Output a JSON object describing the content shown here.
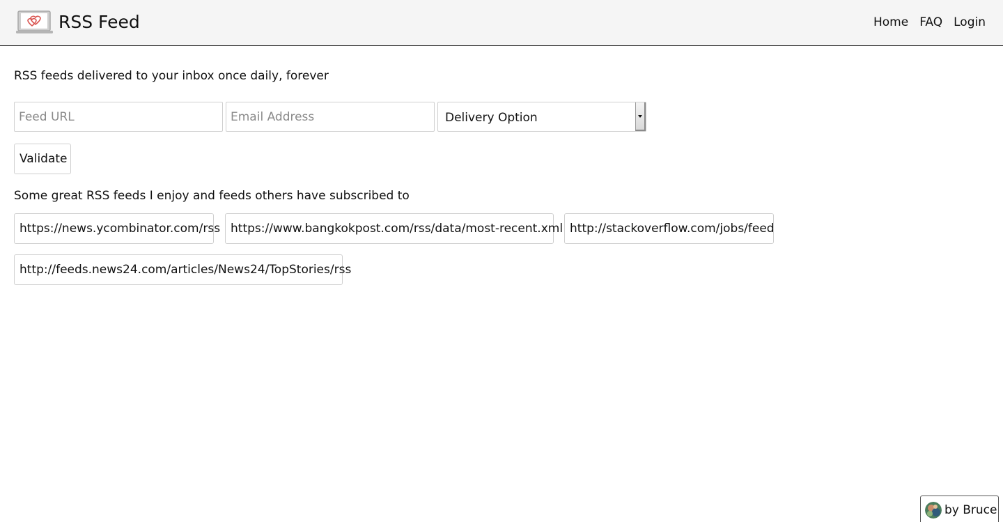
{
  "header": {
    "brand": "RSS Feed",
    "logo_icon": "laptop-heart-icon",
    "nav": [
      {
        "label": "Home"
      },
      {
        "label": "FAQ"
      },
      {
        "label": "Login"
      }
    ]
  },
  "main": {
    "tagline": "RSS feeds delivered to your inbox once daily, forever",
    "form": {
      "feed_url_placeholder": "Feed URL",
      "feed_url_value": "",
      "email_placeholder": "Email Address",
      "email_value": "",
      "delivery_selected": "Delivery Option",
      "validate_label": "Validate"
    },
    "suggestions_heading": "Some great RSS feeds I enjoy and feeds others have subscribed to",
    "suggested_feeds": [
      "https://news.ycombinator.com/rss",
      "https://www.bangkokpost.com/rss/data/most-recent.xml",
      "http://stackoverflow.com/jobs/feed",
      "http://feeds.news24.com/articles/News24/TopStories/rss"
    ]
  },
  "footer_badge": {
    "label": "by Bruce",
    "avatar_icon": "avatar"
  },
  "colors": {
    "header_bg": "#f5f5f5",
    "logo_heart": "#d9534f",
    "border": "#cfcfcf"
  }
}
